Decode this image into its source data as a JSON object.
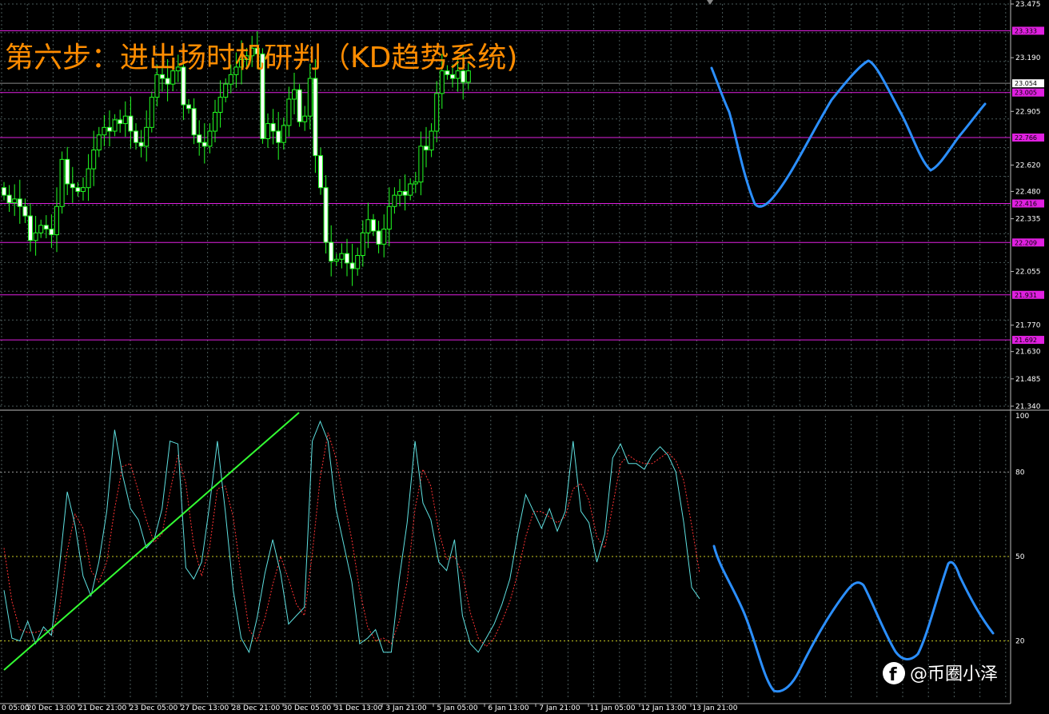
{
  "title": "第六步：进出场时机研判（KD趋势系统)",
  "watermark": "@币圈小泽",
  "colors": {
    "background": "#000000",
    "grid": "#4a5a5a",
    "candle": "#22ff22",
    "level": "#e020e0",
    "kline": "#5ee0e0",
    "dline": "#ff3333",
    "annotation": "#2b8fff",
    "trend": "#33ff33",
    "title": "#ff8c00",
    "price_tag": "#ffffff"
  },
  "chart_data": [
    {
      "type": "candlestick",
      "ylim": [
        21.34,
        23.475
      ],
      "y_ticks": [
        "23.475",
        "23.190",
        "22.905",
        "22.620",
        "22.480",
        "22.335",
        "22.055",
        "21.770",
        "21.630",
        "21.485",
        "21.340"
      ],
      "x_labels": [
        "20 Dec 13:00",
        "21 Dec 21:00",
        "23 Dec 05:00",
        "27 Dec 13:00",
        "28 Dec 21:00",
        "30 Dec 05:00",
        "31 Dec 13:00",
        "3 Jan 21:00",
        "5 Jan 05:00",
        "6 Jan 13:00",
        "7 Jan 21:00",
        "11 Jan 05:00",
        "12 Jan 13:00",
        "13 Jan 21:00"
      ],
      "x_partial_label": "0 05:00",
      "current_price": "23.054",
      "levels": [
        "23.333",
        "23.005",
        "22.766",
        "22.416",
        "22.209",
        "21.931",
        "21.692"
      ],
      "close": [
        22.46,
        22.42,
        22.44,
        22.4,
        22.35,
        22.22,
        22.26,
        22.3,
        22.28,
        22.25,
        22.4,
        22.65,
        22.52,
        22.5,
        22.48,
        22.5,
        22.6,
        22.7,
        22.78,
        22.82,
        22.8,
        22.86,
        22.84,
        22.88,
        22.8,
        22.74,
        22.72,
        22.82,
        22.98,
        23.1,
        23.08,
        23.05,
        23.12,
        23.14,
        22.94,
        22.92,
        22.78,
        22.74,
        22.72,
        22.8,
        22.9,
        22.98,
        23.05,
        23.1,
        23.14,
        23.18,
        23.2,
        23.24,
        23.21,
        22.76,
        22.84,
        22.8,
        22.74,
        22.83,
        22.97,
        23.02,
        22.85,
        22.88,
        23.08,
        22.67,
        22.5,
        22.21,
        22.11,
        22.12,
        22.15,
        22.1,
        22.07,
        22.14,
        22.26,
        22.33,
        22.27,
        22.2,
        22.28,
        22.4,
        22.46,
        22.48,
        22.46,
        22.52,
        22.53,
        22.72,
        22.7,
        22.8,
        23.0,
        23.12,
        23.1,
        23.08,
        23.12,
        23.06,
        23.12
      ],
      "ohlc_note": "open/high/low derived in script from close series",
      "kd": {
        "ylim": [
          0,
          100
        ],
        "y_ticks": [
          "100",
          "80",
          "50",
          "20"
        ],
        "k": [
          38,
          21,
          20,
          27,
          19,
          25,
          22,
          46,
          73,
          61,
          43,
          36,
          48,
          66,
          95,
          79,
          67,
          63,
          53,
          56,
          67,
          91,
          90,
          46,
          42,
          48,
          68,
          91,
          66,
          38,
          21,
          16,
          28,
          44,
          56,
          44,
          26,
          29,
          32,
          91,
          98,
          91,
          67,
          54,
          41,
          19,
          21,
          24,
          16,
          16,
          42,
          62,
          91,
          69,
          63,
          48,
          45,
          56,
          29,
          19,
          16,
          21,
          26,
          33,
          42,
          58,
          72,
          66,
          60,
          67,
          59,
          66,
          91,
          66,
          62,
          48,
          58,
          85,
          90,
          83,
          83,
          81,
          86,
          89,
          86,
          80,
          62,
          39,
          35
        ],
        "d": [
          53,
          34,
          24,
          23,
          23,
          24,
          22,
          31,
          52,
          65,
          60,
          45,
          41,
          48,
          67,
          82,
          83,
          73,
          63,
          55,
          58,
          73,
          86,
          76,
          54,
          43,
          53,
          74,
          75,
          64,
          43,
          24,
          20,
          28,
          40,
          50,
          42,
          33,
          29,
          51,
          78,
          94,
          85,
          70,
          56,
          38,
          25,
          20,
          21,
          19,
          27,
          41,
          67,
          81,
          75,
          59,
          49,
          50,
          44,
          30,
          21,
          18,
          21,
          27,
          34,
          44,
          57,
          66,
          66,
          64,
          62,
          64,
          74,
          76,
          70,
          57,
          53,
          68,
          83,
          86,
          84,
          83,
          83,
          85,
          87,
          84,
          77,
          61,
          44
        ]
      }
    }
  ]
}
